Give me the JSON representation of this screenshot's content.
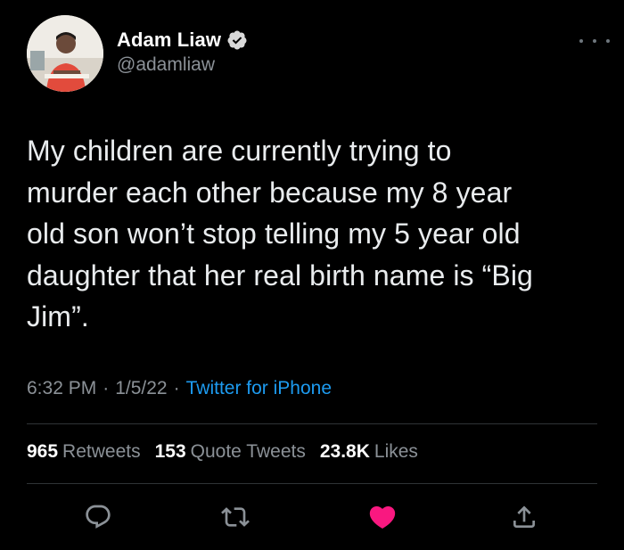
{
  "author": {
    "name": "Adam Liaw",
    "handle": "@adamliaw",
    "verified": true
  },
  "tweet": {
    "text_lines": [
      "My children are currently trying to",
      "murder each other because my 8 year",
      "old son won’t stop telling my 5 year old",
      "daughter that her real birth name is “Big",
      "Jim”."
    ]
  },
  "meta": {
    "time": "6:32 PM",
    "date": "1/5/22",
    "source": "Twitter for iPhone",
    "separator": "·"
  },
  "stats": {
    "retweets_count": "965",
    "retweets_label": "Retweets",
    "quotes_count": "153",
    "quotes_label": "Quote Tweets",
    "likes_count": "23.8K",
    "likes_label": "Likes"
  },
  "actions": {
    "icons": [
      "reply-icon",
      "retweet-icon",
      "like-icon",
      "share-icon"
    ],
    "liked": true
  },
  "colors": {
    "background": "#000000",
    "text": "#e7e9ea",
    "muted": "#8b9197",
    "link": "#1d9bf0",
    "verified": "#d9d9d9",
    "like": "#f91880",
    "divider": "#2f3336"
  }
}
